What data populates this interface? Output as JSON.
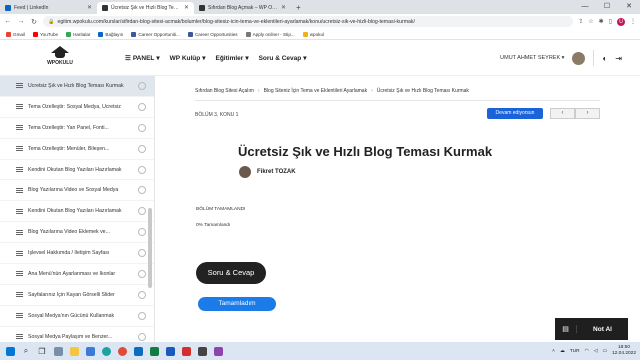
{
  "browser": {
    "tabs": [
      {
        "title": "Feed | LinkedIn",
        "color": "#0a66c2",
        "active": false
      },
      {
        "title": "Ücretsiz Şık ve Hızlı Blog Teması",
        "color": "#333333",
        "active": true
      },
      {
        "title": "Sıfırdan Blog Açmak – WP Okulu",
        "color": "#333333",
        "active": false
      }
    ],
    "url": "egitim.wpokulu.com/kurslar/sifirdan-blog-sitesi-acmak/bolumler/blog-sitesiz-icin-tema-ve-eklentileri-ayarlamak/konu/ucretsiz-sik-ve-hizli-blog-temasi-kurmak/",
    "profile_initial": "U",
    "bookmarks": [
      {
        "label": "Gmail",
        "color": "#ea4335"
      },
      {
        "label": "YouTube",
        "color": "#ff0000"
      },
      {
        "label": "Haritalar",
        "color": "#34a853"
      },
      {
        "label": "Bağlayın",
        "color": "#0a66c2"
      },
      {
        "label": "Career Opportuniti...",
        "color": "#3b5998"
      },
      {
        "label": "Career Opportunities",
        "color": "#3b5998"
      },
      {
        "label": "Apply online! - Stip...",
        "color": "#777777"
      },
      {
        "label": "wpokul",
        "color": "#f2b01e"
      }
    ]
  },
  "site": {
    "logo_text": "WPOKULU",
    "nav": [
      "PANEL",
      "WP Kulüp",
      "Eğitimler",
      "Soru & Cevap"
    ],
    "user_name": "UMUT AHMET SEYREK"
  },
  "sidebar": {
    "items": [
      "Ücretsiz Şık ve Hızlı Blog Teması Kurmak",
      "Tema Özelleştir: Sosyal Medya, Ücretsiz",
      "Tema Özelleştir: Yan Panel, Fonti...",
      "Tema Özelleştir: Menüler, Bileşen...",
      "Kendini Okutan Blog Yazıları Hazırlamak",
      "Blog Yazılarına Video ve Sosyal Medya",
      "Kendini Okutan Blog Yazıları Hazırlamak",
      "Blog Yazılarına Video Eklemek ve...",
      "İşlevsel Hakkımda / İletişim Sayfası",
      "Ana Menü'nün Ayarlanması ve İkonlar",
      "Sayfalarınız İçin Kayan Görselli Slider",
      "Sosyal Medya'nın Gücünü Kullanmak",
      "Sosyal Medya Paylaşım ve Benzer..."
    ]
  },
  "lesson": {
    "breadcrumb": [
      "Sıfırdan Blog Sitesi Açalım",
      "Blog Siteniz İçin Tema ve Eklentileri Ayarlamak",
      "Ücretsiz Şık ve Hızlı Blog Teması Kurmak"
    ],
    "meta": "BÖLÜM 3, KONU 1",
    "resume_label": "Devam ediyorsun",
    "title": "Ücretsiz Şık ve Hızlı Blog Teması Kurmak",
    "author": "Fikret TOZAK",
    "section_status": "BÖLÜM TAMAMLANDI",
    "progress_text": "0% Tamamlandı",
    "qa_button": "Soru & Cevap",
    "complete_button": "Tamamladım"
  },
  "widget": {
    "label": "Not Al"
  },
  "taskbar": {
    "lang": "TUR",
    "time": "18:50",
    "date": "12.04.2022"
  }
}
